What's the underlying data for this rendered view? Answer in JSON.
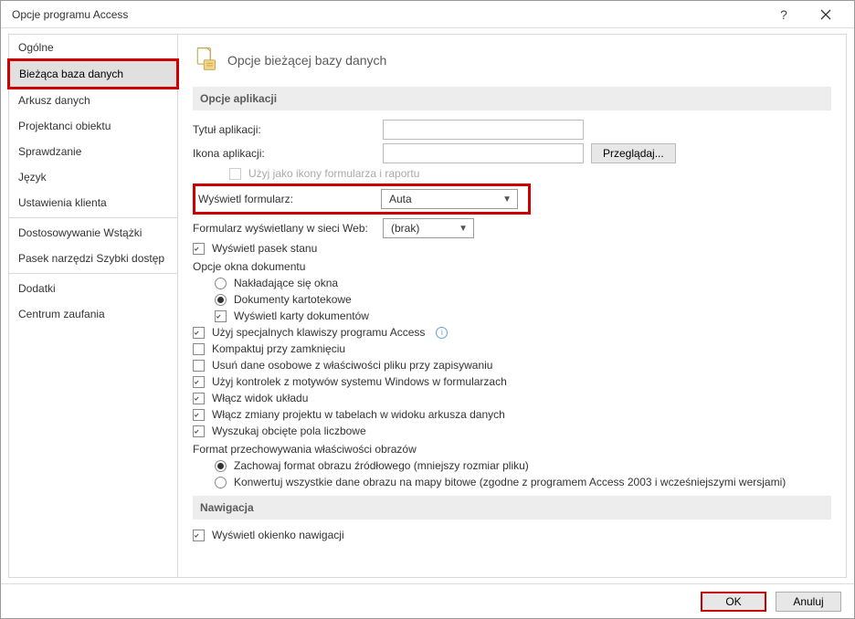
{
  "window": {
    "title": "Opcje programu Access"
  },
  "sidebar": {
    "items": [
      "Ogólne",
      "Bieżąca baza danych",
      "Arkusz danych",
      "Projektanci obiektu",
      "Sprawdzanie",
      "Język",
      "Ustawienia klienta",
      "Dostosowywanie Wstążki",
      "Pasek narzędzi Szybki dostęp",
      "Dodatki",
      "Centrum zaufania"
    ],
    "selected_index": 1
  },
  "header": {
    "title": "Opcje bieżącej bazy danych"
  },
  "sections": {
    "app_options": {
      "title": "Opcje aplikacji",
      "app_title_label": "Tytuł aplikacji:",
      "app_title_value": "",
      "app_icon_label": "Ikona aplikacji:",
      "app_icon_value": "",
      "browse_btn": "Przeglądaj...",
      "use_as_icon_label": "Użyj jako ikony formularza i raportu",
      "use_as_icon_checked": false,
      "display_form_label": "Wyświetl formularz:",
      "display_form_value": "Auta",
      "web_form_label": "Formularz wyświetlany w sieci Web:",
      "web_form_value": "(brak)",
      "status_bar_label": "Wyświetl pasek stanu",
      "status_bar_checked": true,
      "doc_window_label": "Opcje okna dokumentu",
      "overlapping_label": "Nakładające się okna",
      "overlapping_selected": false,
      "tabbed_label": "Dokumenty kartotekowe",
      "tabbed_selected": true,
      "doc_tabs_label": "Wyświetl karty dokumentów",
      "doc_tabs_checked": true,
      "special_keys_label": "Użyj specjalnych klawiszy programu Access",
      "special_keys_checked": true,
      "compact_label": "Kompaktuj przy zamknięciu",
      "compact_checked": false,
      "remove_personal_label": "Usuń dane osobowe z właściwości pliku przy zapisywaniu",
      "remove_personal_checked": false,
      "themed_controls_label": "Użyj kontrolek z motywów systemu Windows w formularzach",
      "themed_controls_checked": true,
      "layout_view_label": "Włącz widok układu",
      "layout_view_checked": true,
      "design_changes_label": "Włącz zmiany projektu w tabelach w widoku arkusza danych",
      "design_changes_checked": true,
      "truncated_nums_label": "Wyszukaj obcięte pola liczbowe",
      "truncated_nums_checked": true,
      "pic_format_label": "Format przechowywania właściwości obrazów",
      "pic_source_label": "Zachowaj format obrazu źródłowego (mniejszy rozmiar pliku)",
      "pic_source_selected": true,
      "pic_bitmap_label": "Konwertuj wszystkie dane obrazu na mapy bitowe (zgodne z programem Access 2003 i wcześniejszymi wersjami)",
      "pic_bitmap_selected": false
    },
    "navigation": {
      "title": "Nawigacja",
      "nav_pane_label": "Wyświetl okienko nawigacji",
      "nav_pane_checked": true
    }
  },
  "footer": {
    "ok": "OK",
    "cancel": "Anuluj"
  }
}
